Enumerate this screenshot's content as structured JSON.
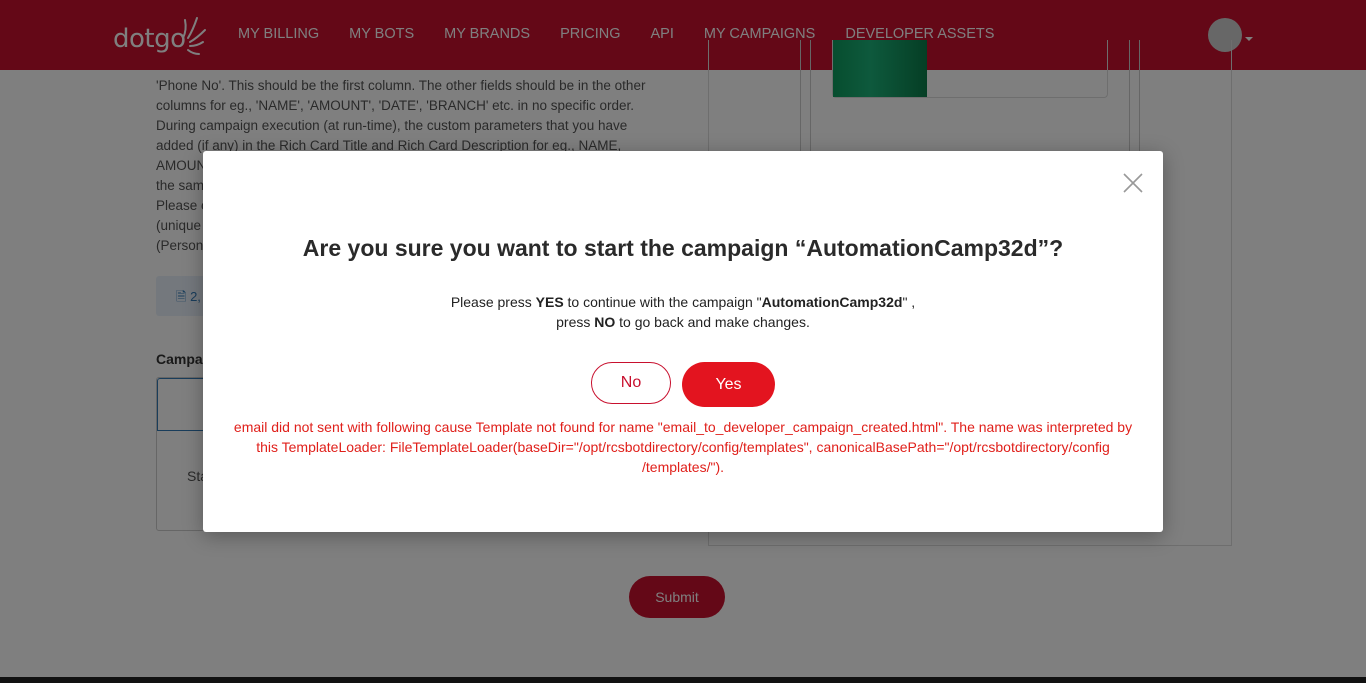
{
  "nav": {
    "logo_text": "dotgo",
    "links": [
      "MY BILLING",
      "MY BOTS",
      "MY BRANDS",
      "PRICING",
      "API",
      "MY CAMPAIGNS",
      "DEVELOPER ASSETS"
    ]
  },
  "background": {
    "instructions": [
      "'Phone No'. This should be the first column. The other fields should be in the other",
      "columns for eg., 'NAME', 'AMOUNT', 'DATE', 'BRANCH' etc. in no specific order.",
      "During campaign execution (at run-time), the custom parameters that you have",
      "added (if any) in the Rich Card Title and Rich Card Description for eg., NAME,",
      "AMOUN",
      "the sam",
      "Please e",
      "(unique",
      " (Person"
    ],
    "file_chip": "2,",
    "campaign_label": "Campa",
    "campaign_start": "Sta",
    "submit_label": "Submit"
  },
  "modal": {
    "title": "Are you sure you want to start the campaign “AutomationCamp32d”?",
    "body_line1_prefix": "Please press ",
    "body_yes": "YES",
    "body_line1_mid": " to continue with the campaign \"",
    "campaign_name": "AutomationCamp32d",
    "body_line1_suffix": "\" ,",
    "body_line2_prefix": "press ",
    "body_no": "NO",
    "body_line2_suffix": " to go back and make changes.",
    "no_label": "No",
    "yes_label": "Yes",
    "error_line1": "email did not sent with following cause Template not found for name \"email_to_developer_campaign_created.html\". The name was interpreted by",
    "error_line2": "this TemplateLoader: FileTemplateLoader(baseDir=\"/opt/rcsbotdirectory/config/templates\", canonicalBasePath=\"/opt/rcsbotdirectory/config",
    "error_line3": "/templates/\")."
  },
  "colors": {
    "brand_red": "#c8102e",
    "error_red": "#e0201b"
  }
}
